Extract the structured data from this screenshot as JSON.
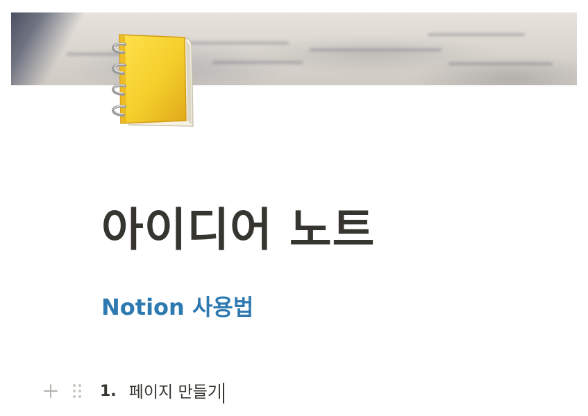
{
  "cover": {
    "image": "blurred-handwritten-notebook-photo"
  },
  "page": {
    "icon": "spiral-notebook-icon",
    "icon_color": "#f4cf2b",
    "title": "아이디어 노트"
  },
  "link": {
    "label": "Notion 사용법",
    "color": "#2e7ab0"
  },
  "list": {
    "items": [
      {
        "number": "1.",
        "text": "페이지 만들기"
      }
    ]
  },
  "handles": {
    "add_icon": "plus-icon",
    "drag_icon": "drag-handle-icon"
  }
}
